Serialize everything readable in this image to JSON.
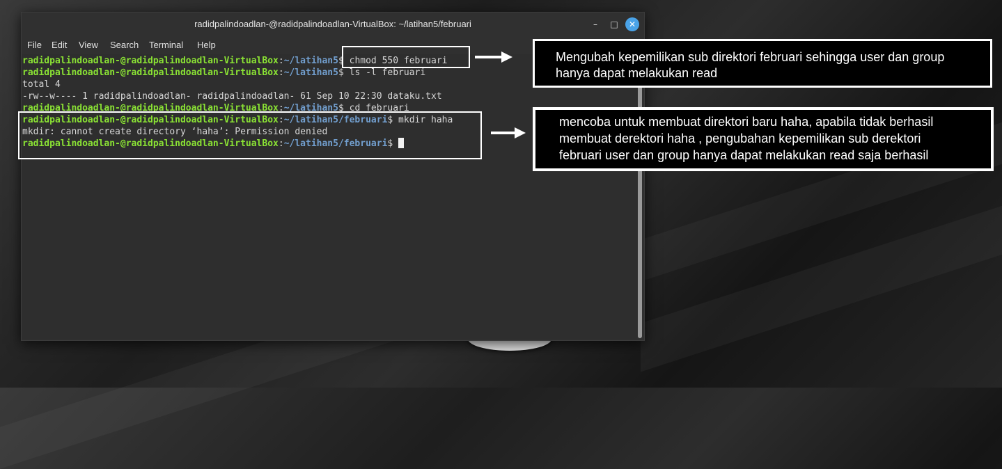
{
  "window": {
    "title": "radidpalindoadlan-@radidpalindoadlan-VirtualBox: ~/latihan5/februari",
    "controls": {
      "minimize_icon": "–",
      "maximize_icon": "□",
      "close_icon": "✕"
    }
  },
  "menu": [
    "File",
    "Edit",
    "View",
    "Search",
    "Terminal",
    "Help"
  ],
  "terminal": {
    "user": "radidpalindoadlan-@radidpalindoadlan-VirtualBox",
    "lines": [
      {
        "path": "~/latihan5",
        "cmd": "$ chmod 550 februari"
      },
      {
        "path": "~/latihan5",
        "cmd": "$ ls -l februari"
      },
      {
        "text": "total 4"
      },
      {
        "text": "-rw--w---- 1 radidpalindoadlan- radidpalindoadlan- 61 Sep 10 22:30 dataku.txt"
      },
      {
        "path": "~/latihan5",
        "cmd": "$ cd februari"
      },
      {
        "path": "~/latihan5/februari",
        "cmd": "$ mkdir haha"
      },
      {
        "text": "mkdir: cannot create directory ‘haha’: Permission denied"
      },
      {
        "path": "~/latihan5/februari",
        "cmd": "$ "
      }
    ]
  },
  "annotations": {
    "note1": [
      "Mengubah kepemilikan sub direktori februari sehingga user dan group",
      "hanya dapat melakukan read"
    ],
    "note2": [
      "mencoba untuk membuat direktori baru haha, apabila tidak berhasil",
      "membuat derektori haha , pengubahan kepemilikan sub derektori",
      "februari user dan group hanya dapat melakukan read saja berhasil"
    ]
  },
  "colors": {
    "prompt_user": "#8ae234",
    "prompt_path": "#729fcf",
    "close_button": "#4aa3e8"
  }
}
